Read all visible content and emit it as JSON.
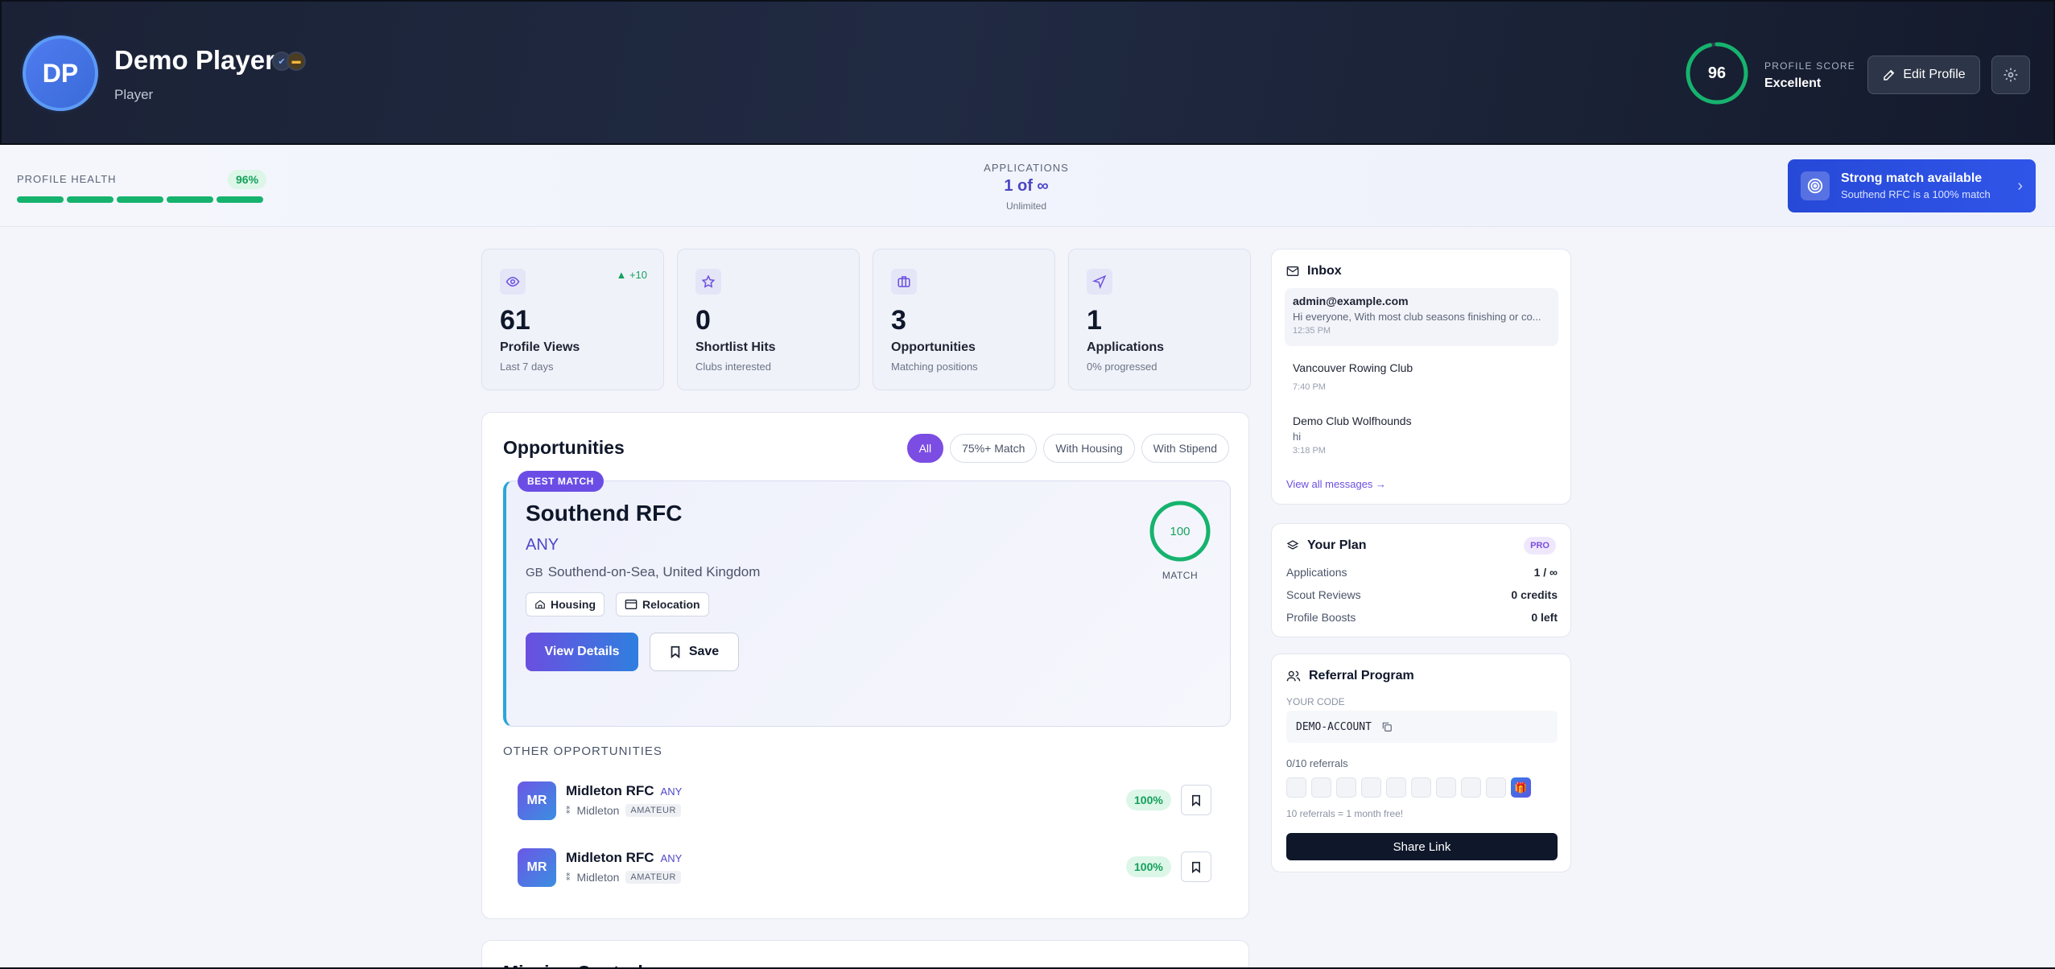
{
  "header": {
    "initials": "DP",
    "name": "Demo Player",
    "role": "Player",
    "score": "96",
    "score_label": "PROFILE SCORE",
    "score_value": "Excellent",
    "score_fraction": 0.96,
    "edit_label": "Edit Profile"
  },
  "status": {
    "health_label": "PROFILE HEALTH",
    "health_pct": "96%",
    "apps_label": "APPLICATIONS",
    "apps_value": "1 of ∞",
    "apps_sub": "Unlimited",
    "banner_title": "Strong match available",
    "banner_sub": "Southend RFC is a 100% match"
  },
  "stats": [
    {
      "num": "61",
      "title": "Profile Views",
      "sub": "Last 7 days",
      "delta": "+10",
      "icon": "eye-icon"
    },
    {
      "num": "0",
      "title": "Shortlist Hits",
      "sub": "Clubs interested",
      "icon": "star-icon"
    },
    {
      "num": "3",
      "title": "Opportunities",
      "sub": "Matching positions",
      "icon": "briefcase-icon"
    },
    {
      "num": "1",
      "title": "Applications",
      "sub": "0% progressed",
      "icon": "send-icon"
    }
  ],
  "opportunities": {
    "title": "Opportunities",
    "filters": [
      "All",
      "75%+ Match",
      "With Housing",
      "With Stipend"
    ],
    "best": {
      "tag": "BEST MATCH",
      "club": "Southend RFC",
      "position": "ANY",
      "country_code": "GB",
      "location": "Southend-on-Sea, United Kingdom",
      "perks": [
        "Housing",
        "Relocation"
      ],
      "view_label": "View Details",
      "save_label": "Save",
      "match": "100",
      "match_label": "MATCH",
      "match_fraction": 1.0
    },
    "other_label": "OTHER OPPORTUNITIES",
    "others": [
      {
        "initials": "MR",
        "club": "Midleton RFC",
        "position": "ANY",
        "location": "Midleton",
        "level": "AMATEUR",
        "pct": "100%"
      },
      {
        "initials": "MR",
        "club": "Midleton RFC",
        "position": "ANY",
        "location": "Midleton",
        "level": "AMATEUR",
        "pct": "100%"
      }
    ],
    "next_title": "Mission Control"
  },
  "inbox": {
    "title": "Inbox",
    "messages": [
      {
        "from": "admin@example.com",
        "body": "Hi everyone, With most club seasons finishing or co...",
        "time": "12:35 PM"
      },
      {
        "from": "Vancouver Rowing Club",
        "body": "",
        "time": "7:40 PM"
      },
      {
        "from": "Demo Club Wolfhounds",
        "body": "hi",
        "time": "3:18 PM"
      }
    ],
    "view_all": "View all messages →"
  },
  "plan": {
    "title": "Your Plan",
    "badge": "PRO",
    "rows": [
      {
        "k": "Applications",
        "v": "1 / ∞"
      },
      {
        "k": "Scout Reviews",
        "v": "0 credits"
      },
      {
        "k": "Profile Boosts",
        "v": "0 left"
      }
    ]
  },
  "referral": {
    "title": "Referral Program",
    "code_label": "YOUR CODE",
    "code": "DEMO-ACCOUNT",
    "count": "0/10 referrals",
    "referrals_done": 0,
    "referrals_total": 10,
    "note": "10 referrals = 1 month free!",
    "share_label": "Share Link"
  },
  "colors": {
    "accent": "#7c4de3",
    "success": "#16b36e",
    "header_bg": "#1b2236",
    "banner": "#2749d8"
  }
}
